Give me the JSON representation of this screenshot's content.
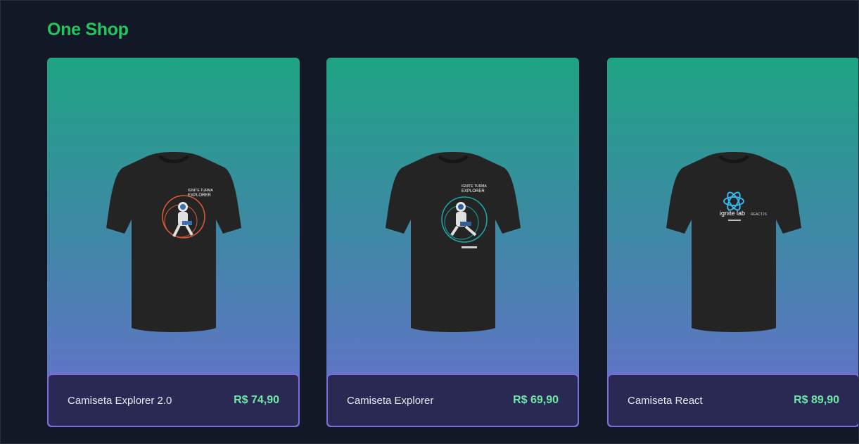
{
  "header": {
    "logo": "One Shop"
  },
  "products": [
    {
      "name": "Camiseta Explorer 2.0",
      "price": "R$ 74,90",
      "image_icon": "tshirt-astronaut-orange-icon",
      "print_line1": "IGNITE TURMA",
      "print_line2": "EXPLORER"
    },
    {
      "name": "Camiseta Explorer",
      "price": "R$ 69,90",
      "image_icon": "tshirt-astronaut-teal-icon",
      "print_line1": "IGNITE TURMA",
      "print_line2": "EXPLORER"
    },
    {
      "name": "Camiseta React",
      "price": "R$ 89,90",
      "image_icon": "tshirt-ignite-lab-icon",
      "print_brand": "ignite lab",
      "print_sub": "REACTJS"
    }
  ],
  "colors": {
    "brand": "#22c55e",
    "price": "#6ee7a6",
    "background": "#121826",
    "card_top": "#1ea483",
    "card_bottom": "#6a6ed0",
    "footer": "#2a2953",
    "footer_border": "#7b6ee0"
  }
}
